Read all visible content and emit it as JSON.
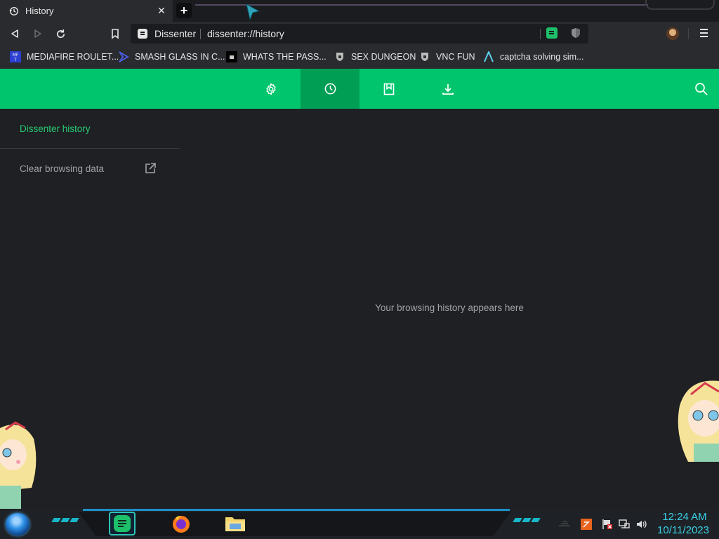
{
  "tab": {
    "title": "History",
    "close": "✕",
    "new_tab": "+"
  },
  "toolbar": {
    "site_name": "Dissenter",
    "url": "dissenter://history"
  },
  "bookmarks": [
    {
      "label": "MEDIAFIRE ROULET...",
      "icon": "mediafire-icon"
    },
    {
      "label": "SMASH GLASS IN C...",
      "icon": "smash-glass-icon"
    },
    {
      "label": "WHATS THE PASS...",
      "icon": "whats-the-pass-icon"
    },
    {
      "label": "SEX DUNGEON",
      "icon": "dungeon-icon"
    },
    {
      "label": "VNC FUN",
      "icon": "vnc-icon"
    },
    {
      "label": "captcha solving sim...",
      "icon": "captcha-icon"
    }
  ],
  "header": {
    "tabs": [
      "settings-icon",
      "history-icon",
      "bookmarks-icon",
      "downloads-icon"
    ],
    "active": "history"
  },
  "sidebar": {
    "title": "Dissenter history",
    "clear": "Clear browsing data"
  },
  "main": {
    "empty_message": "Your browsing history appears here"
  },
  "taskbar": {
    "time": "12:24 AM",
    "date": "10/11/2023"
  },
  "colors": {
    "accent": "#00c56c",
    "accent_active": "#009d55",
    "link": "#27c874",
    "clock": "#3ad0e6"
  }
}
